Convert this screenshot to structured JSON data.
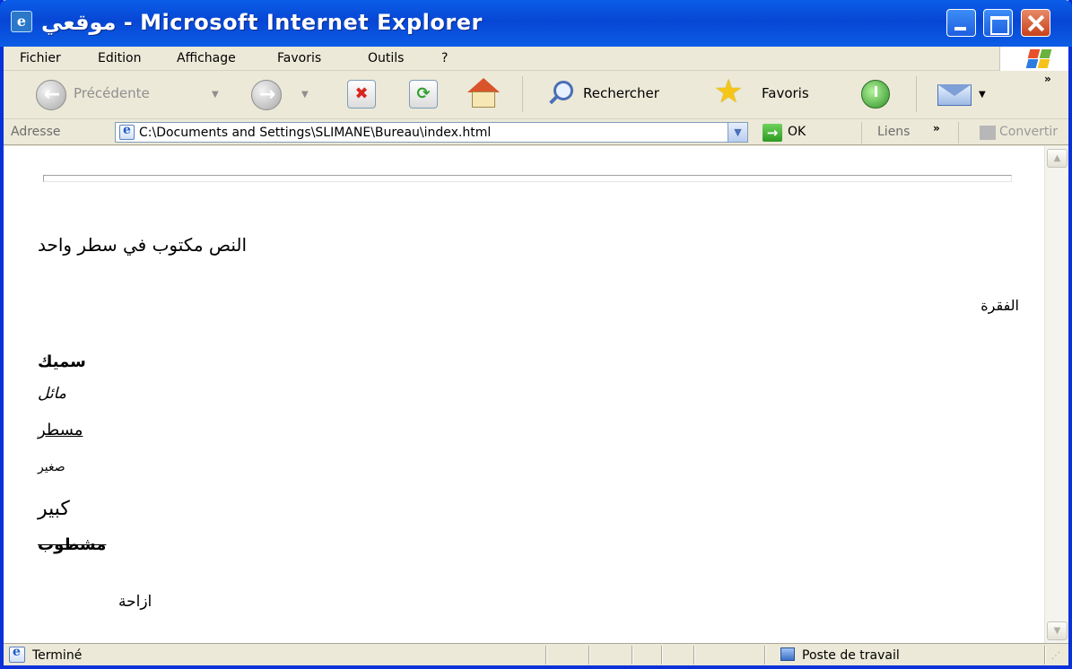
{
  "window": {
    "title": "موقعي - Microsoft Internet Explorer"
  },
  "menu": {
    "items": [
      "Fichier",
      "Edition",
      "Affichage",
      "Favoris",
      "Outils",
      "?"
    ]
  },
  "toolbar": {
    "back_label": "Précédente",
    "search_label": "Rechercher",
    "favorites_label": "Favoris",
    "more_chevron": "»"
  },
  "address": {
    "label": "Adresse",
    "url": "C:\\Documents and Settings\\SLIMANE\\Bureau\\index.html",
    "go_label": "OK",
    "links_label": "Liens",
    "links_chevron": "»",
    "convert_label": "Convertir"
  },
  "content": {
    "single_line_text": "النص مكتوب في سطر واحد",
    "paragraph": "الفقرة",
    "bold": "سميك",
    "italic": "مائل",
    "underline": "مسطر",
    "small": "صغير",
    "big": "كبير",
    "strike": "مشطوب",
    "indent": "ازاحة"
  },
  "status": {
    "text": "Terminé",
    "zone": "Poste de travail"
  },
  "colors": {
    "titlebar": "#0746d4",
    "window_border": "#0831d9",
    "chrome": "#ece9d8"
  }
}
